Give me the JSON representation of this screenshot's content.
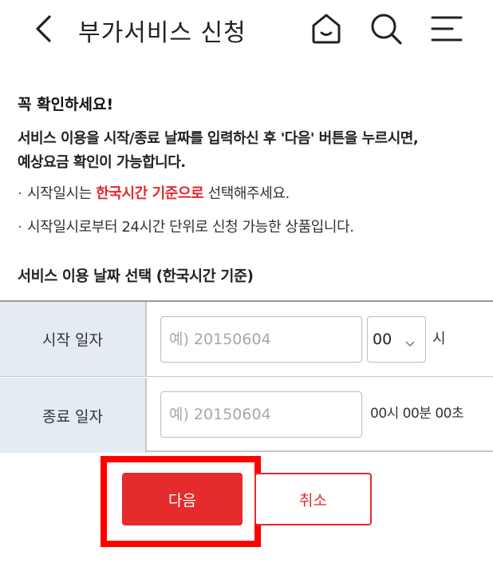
{
  "header": {
    "title": "부가서비스 신청",
    "icons": {
      "back": "back-arrow-icon",
      "home": "home-icon",
      "search": "search-icon",
      "menu": "menu-icon"
    }
  },
  "notice": {
    "title": "꼭 확인하세요!",
    "body_line1": "서비스 이용을 시작/종료 날짜를 입력하신 후 '다음' 버튼을 누르시면,",
    "body_line2": "예상요금 확인이 가능합니다.",
    "bullet1_prefix": "시작일시는 ",
    "bullet1_highlight": "한국시간 기준으로",
    "bullet1_suffix": " 선택해주세요.",
    "bullet2": "시작일시로부터 24시간 단위로 신청 가능한 상품입니다."
  },
  "date_section": {
    "title": "서비스 이용 날짜 선택 (한국시간 기준)",
    "start": {
      "label": "시작 일자",
      "placeholder": "예) 20150604",
      "value": "",
      "hour_selected": "00",
      "hour_unit": "시"
    },
    "end": {
      "label": "종료 일자",
      "placeholder": "예) 20150604",
      "value": "",
      "time_text": "00시 00분 00초"
    }
  },
  "buttons": {
    "next_label": "다음",
    "cancel_label": "취소"
  },
  "colors": {
    "accent": "#e52b2b",
    "highlight_box": "#ff0000",
    "label_bg": "#e4ebf3"
  }
}
